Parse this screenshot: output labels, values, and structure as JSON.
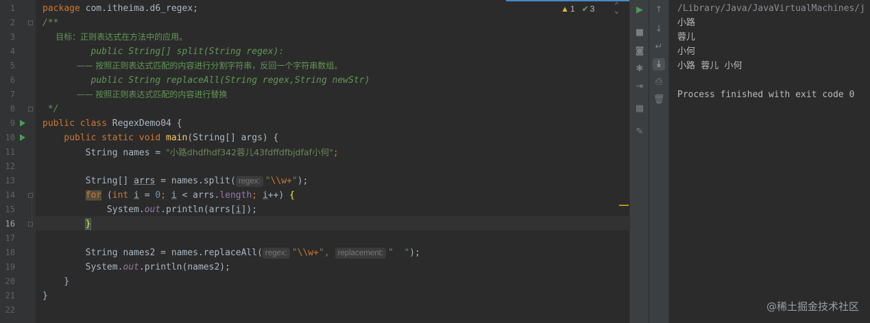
{
  "editor": {
    "line_numbers": [
      "1",
      "2",
      "3",
      "4",
      "5",
      "6",
      "7",
      "8",
      "9",
      "10",
      "11",
      "12",
      "13",
      "14",
      "15",
      "16",
      "17",
      "18",
      "19",
      "20",
      "21",
      "22"
    ],
    "lines": {
      "l1_kw": "package",
      "l1_rest": " com.itheima.d6_regex;",
      "l2": "/**",
      "l3": "     目标：正则表达式在方法中的应用。",
      "l4": "         public String[] split(String regex):",
      "l5": "             —— 按照正则表达式匹配的内容进行分割字符串，反回一个字符串数组。",
      "l6": "         public String replaceAll(String regex,String newStr)",
      "l7": "             —— 按照正则表达式匹配的内容进行替换",
      "l8": " */",
      "l9_kw": "public class",
      "l9_rest": " RegexDemo04 {",
      "l10_kw": "    public static void",
      "l10_fn": "main",
      "l10_rest": "(String[] args) {",
      "l11_a": "        String names = ",
      "l11_str": "\"小路dhdfhdf342蓉儿43fdffdfbjdfaf小何\"",
      "l11_end": ";",
      "l13_a": "        String[] ",
      "l13_var": "arrs",
      "l13_b": " = names.split(",
      "l13_hint": "regex:",
      "l13_q1": "\"",
      "l13_esc": "\\\\w+",
      "l13_q2": "\"",
      "l13_end": ");",
      "l14_kw": "for",
      "l14_a": " (",
      "l14_int": "int",
      "l14_b": " ",
      "l14_i1": "i",
      "l14_c": " = ",
      "l14_zero": "0",
      "l14_d": "; ",
      "l14_i2": "i",
      "l14_e": " < arrs.",
      "l14_len": "length",
      "l14_f": "; ",
      "l14_i3": "i",
      "l14_g": "++) ",
      "l14_brace": "{",
      "l15_a": "            System.",
      "l15_out": "out",
      "l15_b": ".println(arrs[",
      "l15_i": "i",
      "l15_c": "]);",
      "l16_brace": "}",
      "l18_a": "        String names2 = names.replaceAll(",
      "l18_hint1": "regex:",
      "l18_q1": "\"",
      "l18_esc": "\\\\w+",
      "l18_q2": "\",",
      "l18_hint2": "replacement:",
      "l18_str2": "\"  \"",
      "l18_end": ");",
      "l19_a": "        System.",
      "l19_out": "out",
      "l19_b": ".println(names2);",
      "l20": "    }",
      "l21": "}"
    },
    "inspections": {
      "warnings": "1",
      "ok": "3",
      "warn_icon": "warning-triangle-icon",
      "ok_icon": "check-icon"
    }
  },
  "console": {
    "lines": [
      "/Library/Java/JavaVirtualMachines/j",
      "小路",
      "蓉儿",
      "小何",
      "小路  蓉儿  小何",
      "",
      "Process finished with exit code 0"
    ]
  },
  "watermark": "@稀土掘金技术社区",
  "colors": {
    "editor_bg": "#2b2b2b",
    "keyword": "#cc7832",
    "string": "#6a8759",
    "comment": "#629755",
    "method": "#ffc66d",
    "field": "#9876aa",
    "number": "#6897bb"
  }
}
